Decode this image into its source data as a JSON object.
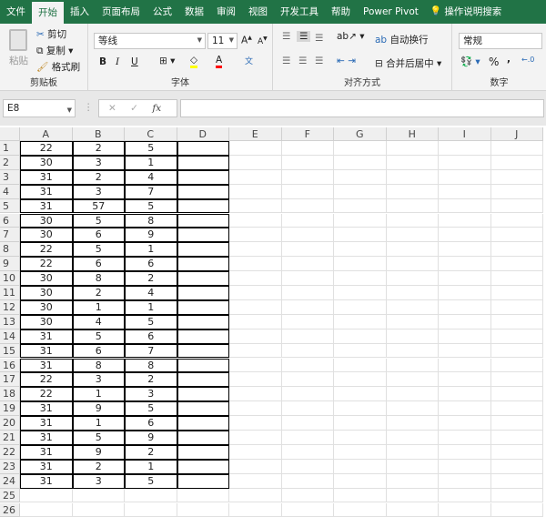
{
  "tabs": [
    "文件",
    "开始",
    "插入",
    "页面布局",
    "公式",
    "数据",
    "审阅",
    "视图",
    "开发工具",
    "帮助",
    "Power Pivot",
    "操作说明搜索"
  ],
  "active_tab": 1,
  "clipboard": {
    "paste": "粘贴",
    "cut": "剪切",
    "copy": "复制",
    "format_painter": "格式刷",
    "label": "剪贴板"
  },
  "font": {
    "name": "等线",
    "size": "11",
    "bold": "B",
    "italic": "I",
    "underline": "U",
    "label": "字体",
    "highlight_color": "#ffff00",
    "font_color": "#ff0000"
  },
  "alignment": {
    "wrap": "自动换行",
    "merge": "合并后居中",
    "label": "对齐方式"
  },
  "number": {
    "format": "常规",
    "percent": "%",
    "comma": ",",
    "label": "数字"
  },
  "formula_bar": {
    "name_box": "E8",
    "cancel": "✕",
    "enter": "✓",
    "fx": "fx",
    "value": ""
  },
  "columns": [
    "A",
    "B",
    "C",
    "D",
    "E",
    "F",
    "G",
    "H",
    "I",
    "J"
  ],
  "row_numbers": [
    1,
    2,
    3,
    4,
    5,
    6,
    7,
    8,
    9,
    10,
    11,
    12,
    13,
    14,
    15,
    16,
    17,
    18,
    19,
    20,
    21,
    22,
    23,
    24,
    25,
    26
  ],
  "rows": [
    [
      22,
      2,
      5
    ],
    [
      30,
      3,
      1
    ],
    [
      31,
      2,
      4
    ],
    [
      31,
      3,
      7
    ],
    [
      31,
      57,
      5
    ],
    [
      30,
      5,
      8
    ],
    [
      30,
      6,
      9
    ],
    [
      22,
      5,
      1
    ],
    [
      22,
      6,
      6
    ],
    [
      30,
      8,
      2
    ],
    [
      30,
      2,
      4
    ],
    [
      30,
      1,
      1
    ],
    [
      30,
      4,
      5
    ],
    [
      31,
      5,
      6
    ],
    [
      31,
      6,
      7
    ],
    [
      31,
      8,
      8
    ],
    [
      22,
      3,
      2
    ],
    [
      22,
      1,
      3
    ],
    [
      31,
      9,
      5
    ],
    [
      31,
      1,
      6
    ],
    [
      31,
      5,
      9
    ],
    [
      31,
      9,
      2
    ],
    [
      31,
      2,
      1
    ],
    [
      31,
      3,
      5
    ]
  ],
  "accent": "#217346"
}
